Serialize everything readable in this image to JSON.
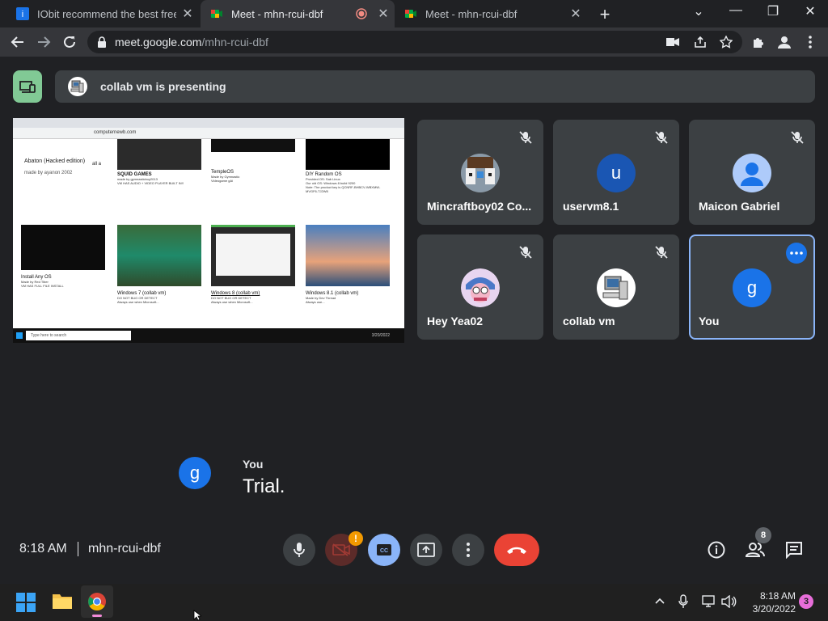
{
  "browser": {
    "tabs": [
      {
        "title": "IObit recommend the best free, fr",
        "favicon": "iobit-icon",
        "active": false
      },
      {
        "title": "Meet - mhn-rcui-dbf",
        "favicon": "meet-icon",
        "active": true
      },
      {
        "title": "Meet - mhn-rcui-dbf",
        "favicon": "meet-icon",
        "active": false
      }
    ],
    "url_host": "meet.google.com",
    "url_path": "/mhn-rcui-dbf"
  },
  "meet": {
    "presenting_text": "collab vm is presenting",
    "shared_screen": {
      "cards": [
        {
          "title": "SQUID GAMES",
          "sub": "made by gymnasticboy2013\nVM HAS AUDIO + VIDEO PLAYER BUILT IN!!"
        },
        {
          "title": "TempleOS",
          "sub": "Made by Gymnastic\nVideogame gAi"
        },
        {
          "title": "DIY Random OS",
          "sub": "Provided OS: Sab Linux\nOur old OS: Windows 8 build 9200\nNote: The product key is QCNRF-BHBCV-WBXMW-MVGF6-TJ2W8"
        },
        {
          "title": "Install Any OS",
          "sub": "Made by Red Tiber\nVM HAS FULL FILE INSTALL"
        },
        {
          "title": "Windows 7 (collab vm)",
          "sub": "DO NOT BUG OR DETECT\nAlways use when Microsoft..."
        },
        {
          "title": "Windows 8 (collab vm)",
          "sub": "DO NOT BUG OR DETECT\nAlways use when Microsoft..."
        },
        {
          "title": "Windows 8.1 (collab vm)",
          "sub": "Made by Dev Thread\nAlways use..."
        }
      ],
      "left_text": "Abaton (Hacked edition)",
      "left_sub": "made by ayanon 2002",
      "left_side": "all a",
      "status_url": "computernewb.com",
      "search_placeholder": "Type here to search",
      "clock": "3/20/2022"
    },
    "participants": [
      {
        "name": "Mincraftboy02 Co...",
        "avatar_kind": "image-minecraft",
        "letter": ""
      },
      {
        "name": "uservm8.1",
        "avatar_kind": "letter",
        "letter": "u",
        "color": "#1a56b3"
      },
      {
        "name": "Maicon Gabriel",
        "avatar_kind": "default-person",
        "letter": ""
      },
      {
        "name": "Hey Yea02",
        "avatar_kind": "image-cartoon",
        "letter": ""
      },
      {
        "name": "collab vm",
        "avatar_kind": "image-computer",
        "letter": ""
      },
      {
        "name": "You",
        "avatar_kind": "letter",
        "letter": "g",
        "color": "#1a73e8",
        "highlighted": true
      }
    ],
    "caption": {
      "avatar_letter": "g",
      "speaker": "You",
      "text": "Trial."
    },
    "bottom": {
      "time": "8:18 AM",
      "meeting_code": "mhn-rcui-dbf",
      "people_count": "8",
      "camera_alert": "!"
    }
  },
  "taskbar": {
    "time": "8:18 AM",
    "date": "3/20/2022",
    "notifications": "3"
  },
  "colors": {
    "background": "#202124",
    "tile": "#3c4043",
    "end_call": "#ea4335",
    "cc_active": "#8ab4f8",
    "highlight": "#8ab4f8",
    "present_green": "#81c995",
    "alert": "#f29900"
  }
}
